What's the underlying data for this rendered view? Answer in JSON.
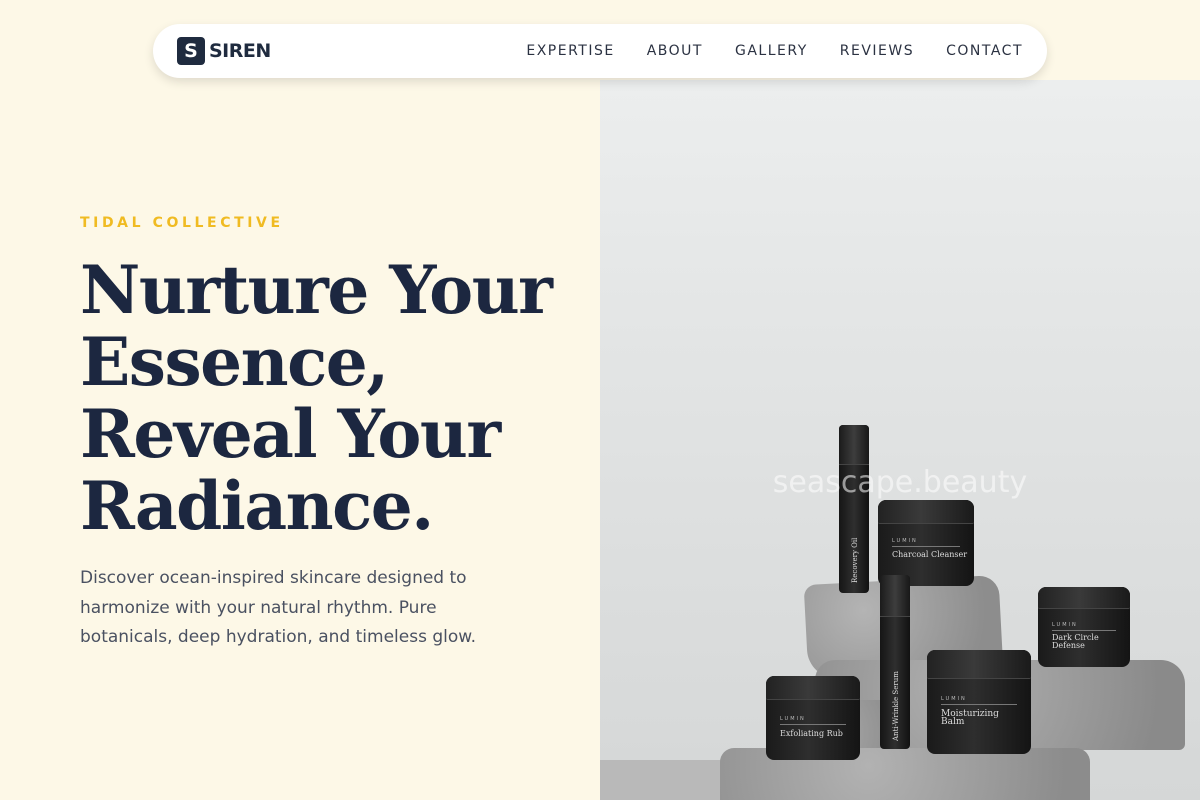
{
  "nav": {
    "logo_mark": "S",
    "logo_text": "SIREN",
    "links": [
      "EXPERTISE",
      "ABOUT",
      "GALLERY",
      "REVIEWS",
      "CONTACT"
    ]
  },
  "hero": {
    "eyebrow": "TIDAL COLLECTIVE",
    "headline": [
      "Nurture Your",
      "Essence,",
      "Reveal Your",
      "Radiance."
    ],
    "lead": "Discover ocean-inspired skincare designed to harmonize with your natural rhythm. Pure botanicals, deep hydration, and timeless glow."
  },
  "image": {
    "watermark": "seascape.beauty",
    "products": {
      "brand": "LUMIN",
      "recovery_oil": "Recovery Oil",
      "charcoal_cleanser": "Charcoal Cleanser",
      "dark_circle_defense": "Dark Circle Defense",
      "anti_wrinkle_serum": "Anti-Wrinkle Serum",
      "moisturizing_balm": "Moisturizing Balm",
      "exfoliating_rub": "Exfoliating Rub"
    }
  },
  "colors": {
    "background": "#fdf8e7",
    "navy": "#1c2740",
    "accent": "#f0bb22"
  }
}
